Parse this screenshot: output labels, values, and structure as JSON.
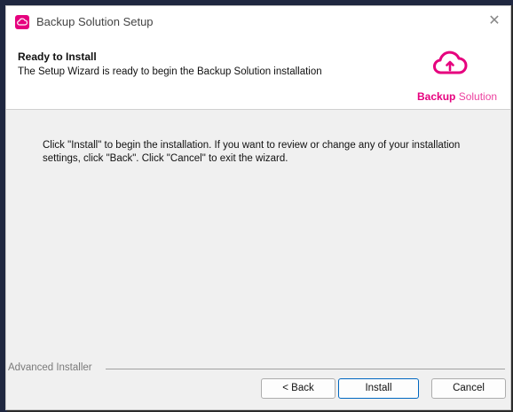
{
  "window": {
    "title": "Backup Solution Setup",
    "close_glyph": "✕"
  },
  "header": {
    "heading": "Ready to Install",
    "subheading": "The Setup Wizard is ready to begin the Backup Solution installation",
    "brand_bold": "Backup",
    "brand_light": " Solution",
    "brand_color": "#e6007e"
  },
  "main": {
    "message": "Click \"Install\" to begin the installation.  If you want to review or change any of your installation settings, click \"Back\".  Click \"Cancel\" to exit the wizard."
  },
  "footer": {
    "installer_label": "Advanced Installer",
    "back_label": "< Back",
    "install_label": "Install",
    "cancel_label": "Cancel"
  },
  "icons": {
    "app": "cloud-backup-icon",
    "brand": "cloud-upload-icon",
    "close": "close-icon"
  }
}
